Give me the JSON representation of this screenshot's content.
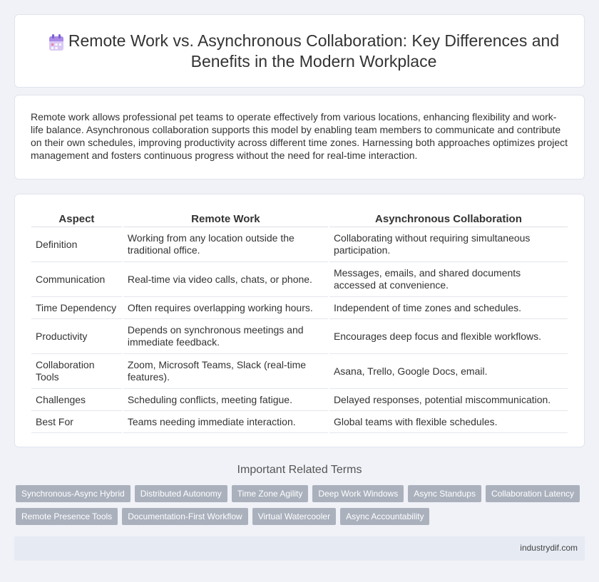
{
  "header": {
    "title": "Remote Work vs. Asynchronous Collaboration: Key Differences and Benefits in the Modern Workplace",
    "icon": "calendar-icon"
  },
  "intro": {
    "text": "Remote work allows professional pet teams to operate effectively from various locations, enhancing flexibility and work-life balance. Asynchronous collaboration supports this model by enabling team members to communicate and contribute on their own schedules, improving productivity across different time zones. Harnessing both approaches optimizes project management and fosters continuous progress without the need for real-time interaction."
  },
  "table": {
    "headers": [
      "Aspect",
      "Remote Work",
      "Asynchronous Collaboration"
    ],
    "rows": [
      [
        "Definition",
        "Working from any location outside the traditional office.",
        "Collaborating without requiring simultaneous participation."
      ],
      [
        "Communication",
        "Real-time via video calls, chats, or phone.",
        "Messages, emails, and shared documents accessed at convenience."
      ],
      [
        "Time Dependency",
        "Often requires overlapping working hours.",
        "Independent of time zones and schedules."
      ],
      [
        "Productivity",
        "Depends on synchronous meetings and immediate feedback.",
        "Encourages deep focus and flexible workflows."
      ],
      [
        "Collaboration Tools",
        "Zoom, Microsoft Teams, Slack (real-time features).",
        "Asana, Trello, Google Docs, email."
      ],
      [
        "Challenges",
        "Scheduling conflicts, meeting fatigue.",
        "Delayed responses, potential miscommunication."
      ],
      [
        "Best For",
        "Teams needing immediate interaction.",
        "Global teams with flexible schedules."
      ]
    ]
  },
  "related": {
    "title": "Important Related Terms",
    "row1": [
      "Synchronous-Async Hybrid",
      "Distributed Autonomy",
      "Time Zone Agility",
      "Deep Work Windows",
      "Async Standups",
      "Collaboration Latency"
    ],
    "row2": [
      "Remote Presence Tools",
      "Documentation-First Workflow",
      "Virtual Watercooler",
      "Async Accountability"
    ]
  },
  "footer": {
    "site": "industrydif.com"
  }
}
